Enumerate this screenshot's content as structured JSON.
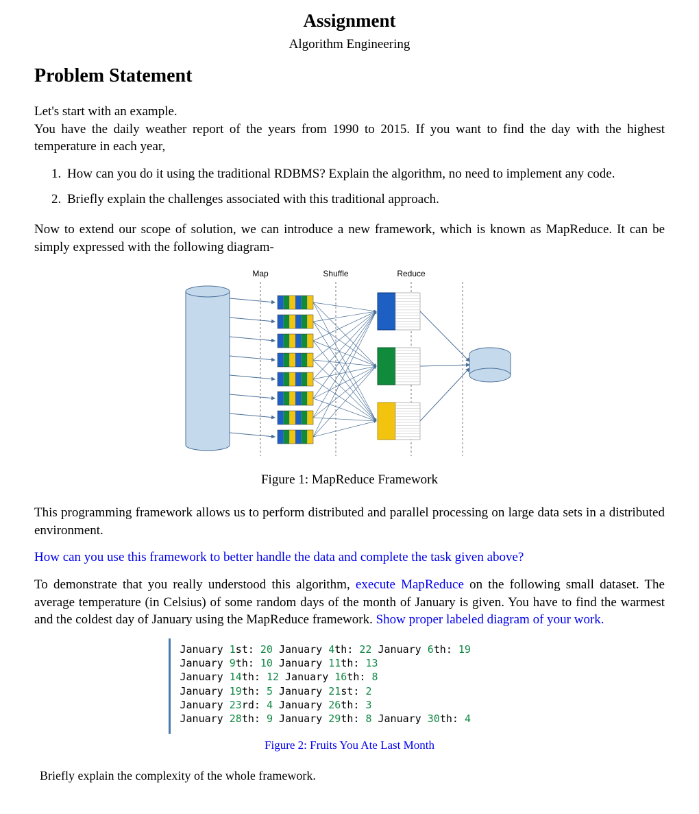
{
  "header": {
    "title": "Assignment",
    "subtitle": "Algorithm Engineering"
  },
  "section_heading": "Problem Statement",
  "intro_para": "Let's start with an example.\nYou have the daily weather report of the years from 1990 to 2015. If you want to find the day with the highest temperature in each year,",
  "questions": [
    "How can you do it using the traditional RDBMS? Explain the algorithm, no need to implement any code.",
    "Briefly explain the challenges associated with this traditional approach."
  ],
  "scope_para": "Now to extend our scope of solution, we can introduce a new framework, which is known as MapReduce. It can be simply expressed with the following diagram-",
  "mr_diagram": {
    "phase_labels": [
      "Map",
      "Shuffle",
      "Reduce"
    ],
    "caption": "Figure 1: MapReduce Framework"
  },
  "framework_para": "This programming framework allows us to perform distributed and parallel processing on large data sets in a distributed environment.",
  "blue_question": "How can you use this framework to better handle the data and complete the task given above?",
  "demo_para": {
    "pre": "To demonstrate that you really understood this algorithm, ",
    "blue1": "execute MapReduce",
    "mid": " on the following small dataset. The average temperature (in Celsius) of some random days of the month of January is given. You have to find the warmest and the coldest day of January using the MapReduce framework. ",
    "blue2": "Show proper labeled diagram of your work."
  },
  "dataset": [
    [
      [
        "January",
        "1",
        "st",
        "20"
      ],
      [
        "January",
        "4",
        "th",
        "22"
      ],
      [
        "January",
        "6",
        "th",
        "19"
      ]
    ],
    [
      [
        "January",
        "9",
        "th",
        "10"
      ],
      [
        "January",
        "11",
        "th",
        "13"
      ]
    ],
    [
      [
        "January",
        "14",
        "th",
        "12"
      ],
      [
        "January",
        "16",
        "th",
        "8"
      ]
    ],
    [
      [
        "January",
        "19",
        "th",
        "5"
      ],
      [
        "January",
        "21",
        "st",
        "2"
      ]
    ],
    [
      [
        "January",
        "23",
        "rd",
        "4"
      ],
      [
        "January",
        "26",
        "th",
        "3"
      ]
    ],
    [
      [
        "January",
        "28",
        "th",
        "9"
      ],
      [
        "January",
        "29",
        "th",
        "8"
      ],
      [
        "January",
        "30",
        "th",
        "4"
      ]
    ]
  ],
  "fig2_caption": "Figure 2: Fruits You Ate Last Month",
  "closing": "Briefly explain the complexity of the whole framework.",
  "colors": {
    "disk_fill": "#c5d9ed",
    "disk_stroke": "#4a7099",
    "blue_block": "#1d5fc2",
    "green_block": "#0f8b3b",
    "yellow_block": "#f2c40f",
    "line": "#4a7099"
  }
}
